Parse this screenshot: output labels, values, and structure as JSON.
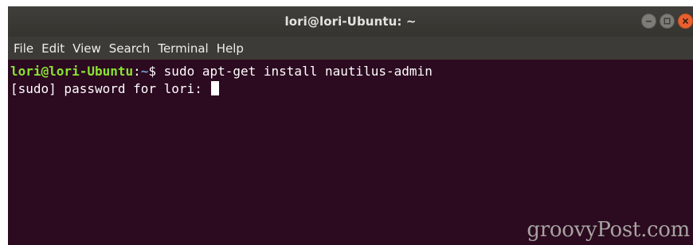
{
  "window": {
    "title": "lori@lori-Ubuntu: ~",
    "controls": [
      "minimize-icon",
      "maximize-icon",
      "close-icon"
    ]
  },
  "menu": {
    "items": [
      "File",
      "Edit",
      "View",
      "Search",
      "Terminal",
      "Help"
    ]
  },
  "terminal": {
    "lines": [
      {
        "prompt_user": "lori@lori-Ubuntu",
        "prompt_sep": ":",
        "prompt_path": "~",
        "prompt_symbol": "$ ",
        "command": "sudo apt-get install nautilus-admin"
      },
      {
        "text": "[sudo] password for lori: "
      }
    ]
  },
  "watermark": "groovyPost.com",
  "colors": {
    "terminal_bg": "#2c0a20",
    "prompt_user": "#8ae234",
    "prompt_path": "#729fcf",
    "close_button": "#e9602e"
  }
}
